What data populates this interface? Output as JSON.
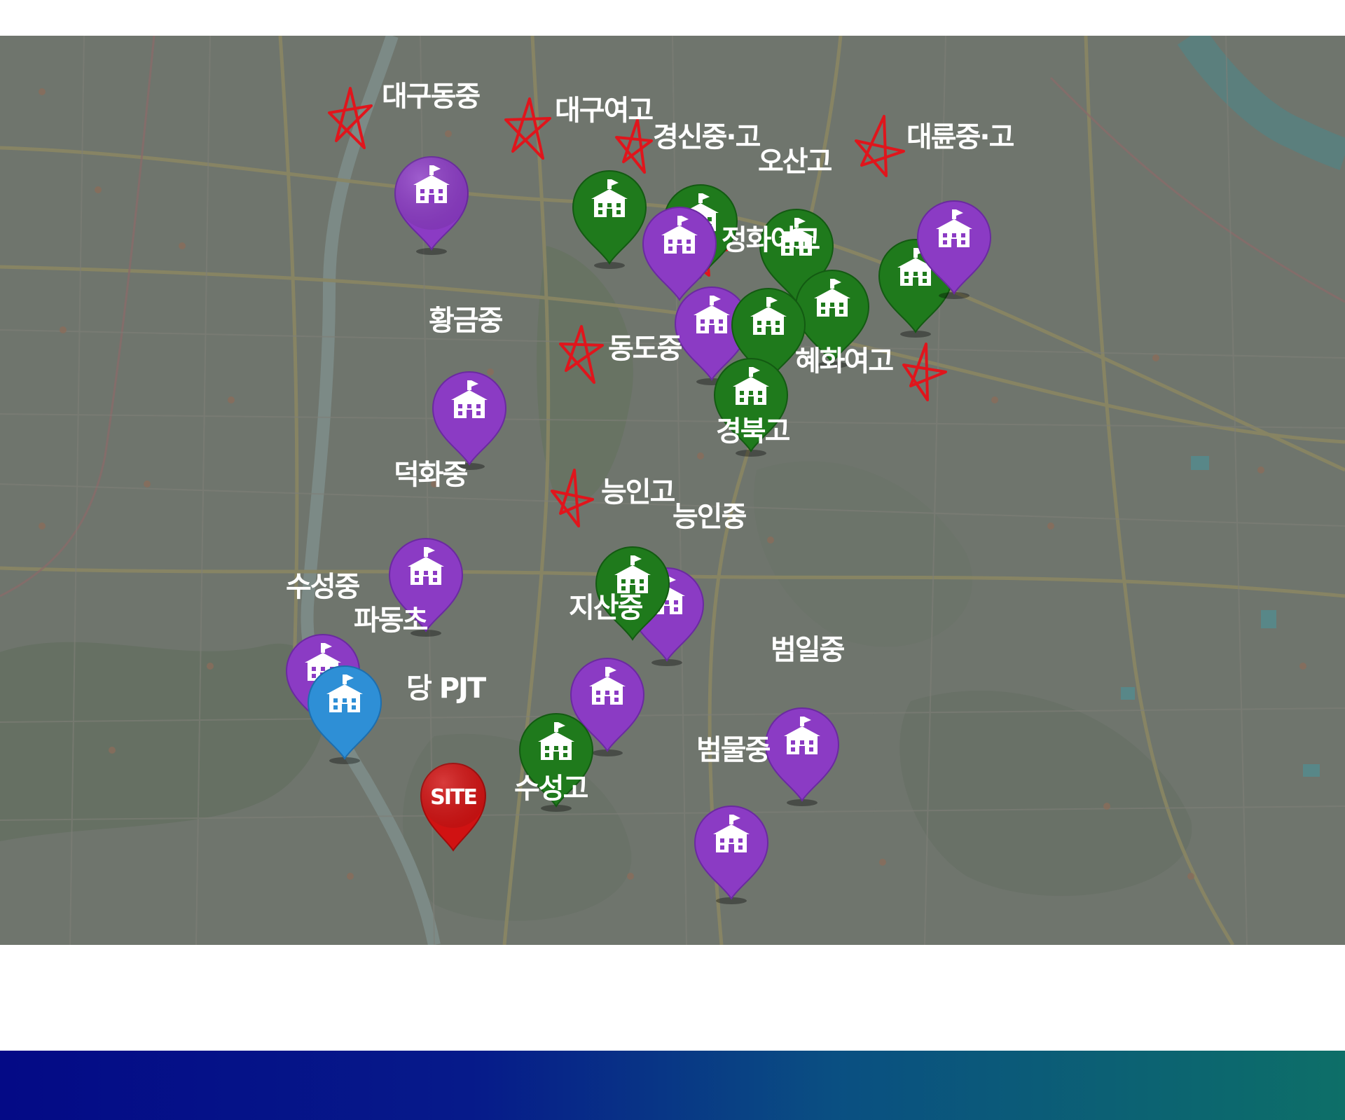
{
  "colors": {
    "high_school_pin": "#1f7a1c",
    "middle_school_pin": "#8b3bc4",
    "elementary_school_pin": "#2e8fd6",
    "site_pin": "#d01212",
    "strike_mark": "#e0151c",
    "label_text": "#ffffff",
    "bottom_band_start": "#040a86",
    "bottom_band_end": "#0d6f68"
  },
  "map": {
    "site_marker": {
      "text": "SITE"
    },
    "site_label": "당 PJT",
    "labels": {
      "daegu_dong_mid": "대구동중",
      "daegu_girls_high": "대구여고",
      "kyungshin": "경신중·고",
      "daeryun": "대륜중·고",
      "osan_high": "오산고",
      "junghwa_girls_high": "정화여고",
      "hwanggeum_mid": "황금중",
      "dongdo_mid": "동도중",
      "hyehwa_girls_high": "혜화여고",
      "kyungbuk_high": "경북고",
      "deokhwa_mid": "덕화중",
      "neungin_high": "능인고",
      "neungin_mid": "능인중",
      "suseong_mid": "수성중",
      "padong_elem": "파동초",
      "jisan_mid": "지산중",
      "beomil_mid": "범일중",
      "suseong_high": "수성고",
      "beommul_mid": "범물중"
    }
  }
}
